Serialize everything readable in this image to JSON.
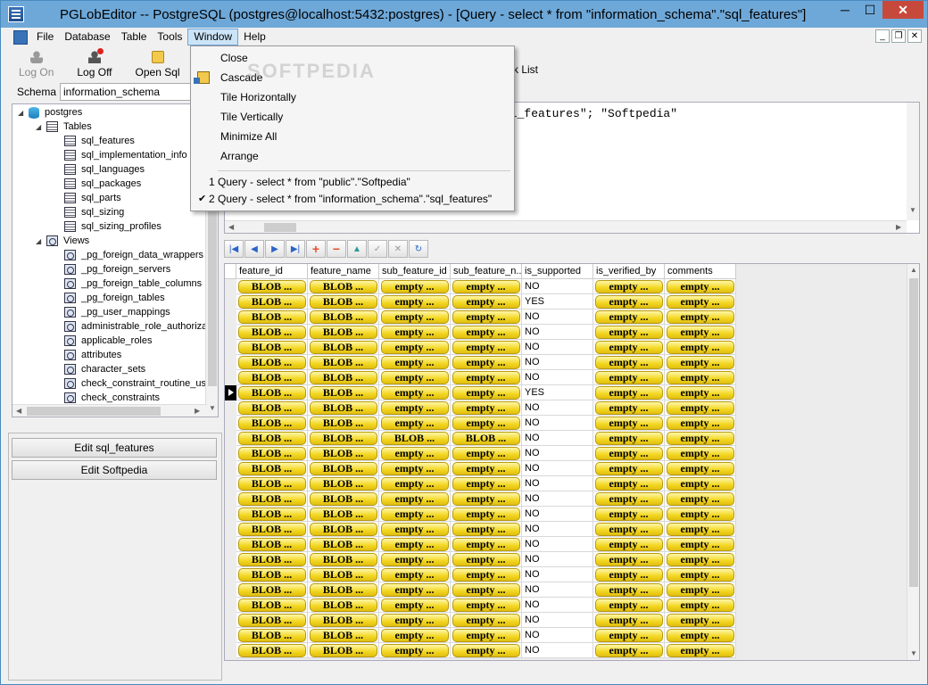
{
  "window": {
    "title": "PGLobEditor -- PostgreSQL (postgres@localhost:5432:postgres) - [Query - select * from \"information_schema\".\"sql_features\"]",
    "controls": {
      "minimize": "─",
      "maximize": "☐",
      "close": "✕"
    }
  },
  "menubar": {
    "items": [
      "File",
      "Database",
      "Table",
      "Tools",
      "Window",
      "Help"
    ],
    "active": "Window",
    "mdi": {
      "minimize": "_",
      "restore": "❐",
      "close": "✕"
    }
  },
  "toolbar": {
    "log_on": "Log On",
    "log_off": "Log Off",
    "open_sql": "Open Sql",
    "task_list": "sk List"
  },
  "schema": {
    "label": "Schema",
    "value": "information_schema"
  },
  "tree": {
    "root": "postgres",
    "tables_label": "Tables",
    "tables": [
      "sql_features",
      "sql_implementation_info",
      "sql_languages",
      "sql_packages",
      "sql_parts",
      "sql_sizing",
      "sql_sizing_profiles"
    ],
    "views_label": "Views",
    "views": [
      "_pg_foreign_data_wrappers",
      "_pg_foreign_servers",
      "_pg_foreign_table_columns",
      "_pg_foreign_tables",
      "_pg_user_mappings",
      "administrable_role_authoriza",
      "applicable_roles",
      "attributes",
      "character_sets",
      "check_constraint_routine_us",
      "check_constraints",
      "collation_character_set_app"
    ]
  },
  "left_buttons": {
    "edit_sql_features": "Edit sql_features",
    "edit_softpedia": "Edit Softpedia"
  },
  "editor": {
    "visible_text": "ql_features\"; \"Softpedia\""
  },
  "navigator": {
    "first": "|◀",
    "prev": "◀",
    "next": "▶",
    "last": "▶|",
    "insert": "+",
    "delete": "−",
    "edit": "▲",
    "post": "✓",
    "cancel": "✕",
    "refresh": "↻"
  },
  "grid": {
    "columns": [
      "feature_id",
      "feature_name",
      "sub_feature_id",
      "sub_feature_n...",
      "is_supported",
      "is_verified_by",
      "comments"
    ],
    "current_row": 7,
    "rows": [
      [
        "BLOB ...",
        "BLOB ...",
        "empty ...",
        "empty ...",
        "NO",
        "empty ...",
        "empty ..."
      ],
      [
        "BLOB ...",
        "BLOB ...",
        "empty ...",
        "empty ...",
        "YES",
        "empty ...",
        "empty ..."
      ],
      [
        "BLOB ...",
        "BLOB ...",
        "empty ...",
        "empty ...",
        "NO",
        "empty ...",
        "empty ..."
      ],
      [
        "BLOB ...",
        "BLOB ...",
        "empty ...",
        "empty ...",
        "NO",
        "empty ...",
        "empty ..."
      ],
      [
        "BLOB ...",
        "BLOB ...",
        "empty ...",
        "empty ...",
        "NO",
        "empty ...",
        "empty ..."
      ],
      [
        "BLOB ...",
        "BLOB ...",
        "empty ...",
        "empty ...",
        "NO",
        "empty ...",
        "empty ..."
      ],
      [
        "BLOB ...",
        "BLOB ...",
        "empty ...",
        "empty ...",
        "NO",
        "empty ...",
        "empty ..."
      ],
      [
        "BLOB ...",
        "BLOB ...",
        "empty ...",
        "empty ...",
        "YES",
        "empty ...",
        "empty ..."
      ],
      [
        "BLOB ...",
        "BLOB ...",
        "empty ...",
        "empty ...",
        "NO",
        "empty ...",
        "empty ..."
      ],
      [
        "BLOB ...",
        "BLOB ...",
        "empty ...",
        "empty ...",
        "NO",
        "empty ...",
        "empty ..."
      ],
      [
        "BLOB ...",
        "BLOB ...",
        "BLOB ...",
        "BLOB ...",
        "NO",
        "empty ...",
        "empty ..."
      ],
      [
        "BLOB ...",
        "BLOB ...",
        "empty ...",
        "empty ...",
        "NO",
        "empty ...",
        "empty ..."
      ],
      [
        "BLOB ...",
        "BLOB ...",
        "empty ...",
        "empty ...",
        "NO",
        "empty ...",
        "empty ..."
      ],
      [
        "BLOB ...",
        "BLOB ...",
        "empty ...",
        "empty ...",
        "NO",
        "empty ...",
        "empty ..."
      ],
      [
        "BLOB ...",
        "BLOB ...",
        "empty ...",
        "empty ...",
        "NO",
        "empty ...",
        "empty ..."
      ],
      [
        "BLOB ...",
        "BLOB ...",
        "empty ...",
        "empty ...",
        "NO",
        "empty ...",
        "empty ..."
      ],
      [
        "BLOB ...",
        "BLOB ...",
        "empty ...",
        "empty ...",
        "NO",
        "empty ...",
        "empty ..."
      ],
      [
        "BLOB ...",
        "BLOB ...",
        "empty ...",
        "empty ...",
        "NO",
        "empty ...",
        "empty ..."
      ],
      [
        "BLOB ...",
        "BLOB ...",
        "empty ...",
        "empty ...",
        "NO",
        "empty ...",
        "empty ..."
      ],
      [
        "BLOB ...",
        "BLOB ...",
        "empty ...",
        "empty ...",
        "NO",
        "empty ...",
        "empty ..."
      ],
      [
        "BLOB ...",
        "BLOB ...",
        "empty ...",
        "empty ...",
        "NO",
        "empty ...",
        "empty ..."
      ],
      [
        "BLOB ...",
        "BLOB ...",
        "empty ...",
        "empty ...",
        "NO",
        "empty ...",
        "empty ..."
      ],
      [
        "BLOB ...",
        "BLOB ...",
        "empty ...",
        "empty ...",
        "NO",
        "empty ...",
        "empty ..."
      ],
      [
        "BLOB ...",
        "BLOB ...",
        "empty ...",
        "empty ...",
        "NO",
        "empty ...",
        "empty ..."
      ],
      [
        "BLOB ...",
        "BLOB ...",
        "empty ...",
        "empty ...",
        "NO",
        "empty ...",
        "empty ..."
      ]
    ]
  },
  "window_menu": {
    "items": [
      "Close",
      "Cascade",
      "Tile Horizontally",
      "Tile Vertically",
      "Minimize All",
      "Arrange"
    ],
    "windows": [
      "1 Query - select * from \"public\".\"Softpedia\"",
      "2 Query - select * from \"information_schema\".\"sql_features\""
    ],
    "checked_index": 1,
    "check_mark": "✔"
  },
  "watermark": "SOFTPEDIA"
}
